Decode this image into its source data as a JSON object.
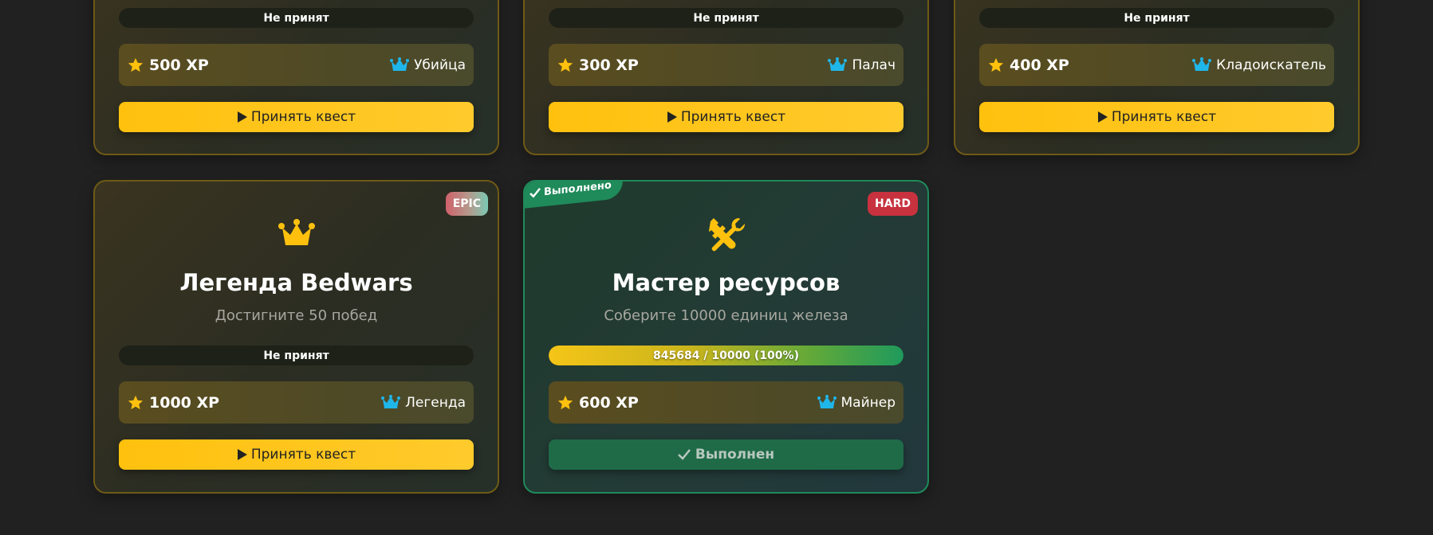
{
  "top_cards": [
    {
      "status": "Не принят",
      "xp": "500 XP",
      "title_reward": "Убийца",
      "button": "Принять квест"
    },
    {
      "status": "Не принят",
      "xp": "300 XP",
      "title_reward": "Палач",
      "button": "Принять квест"
    },
    {
      "status": "Не принят",
      "xp": "400 XP",
      "title_reward": "Кладоискатель",
      "button": "Принять квест"
    }
  ],
  "legend_card": {
    "difficulty": "EPIC",
    "icon": "crown-icon",
    "title": "Легенда Bedwars",
    "description": "Достигните 50 побед",
    "status": "Не принят",
    "xp": "1000 XP",
    "title_reward": "Легенда",
    "button": "Принять квест"
  },
  "master_card": {
    "ribbon": "Выполнено",
    "difficulty": "HARD",
    "icon": "tools-icon",
    "title": "Мастер ресурсов",
    "description": "Соберите 10000 единиц железа",
    "progress_text": "845684 / 10000 (100%)",
    "progress_fraction": 1.0,
    "xp": "600 XP",
    "title_reward": "Майнер",
    "button": "Выполнен"
  },
  "colors": {
    "accent": "#ffc10e",
    "success": "#1f8a5a",
    "crown_blue": "#1fb6ea",
    "hard": "#c7323e"
  }
}
